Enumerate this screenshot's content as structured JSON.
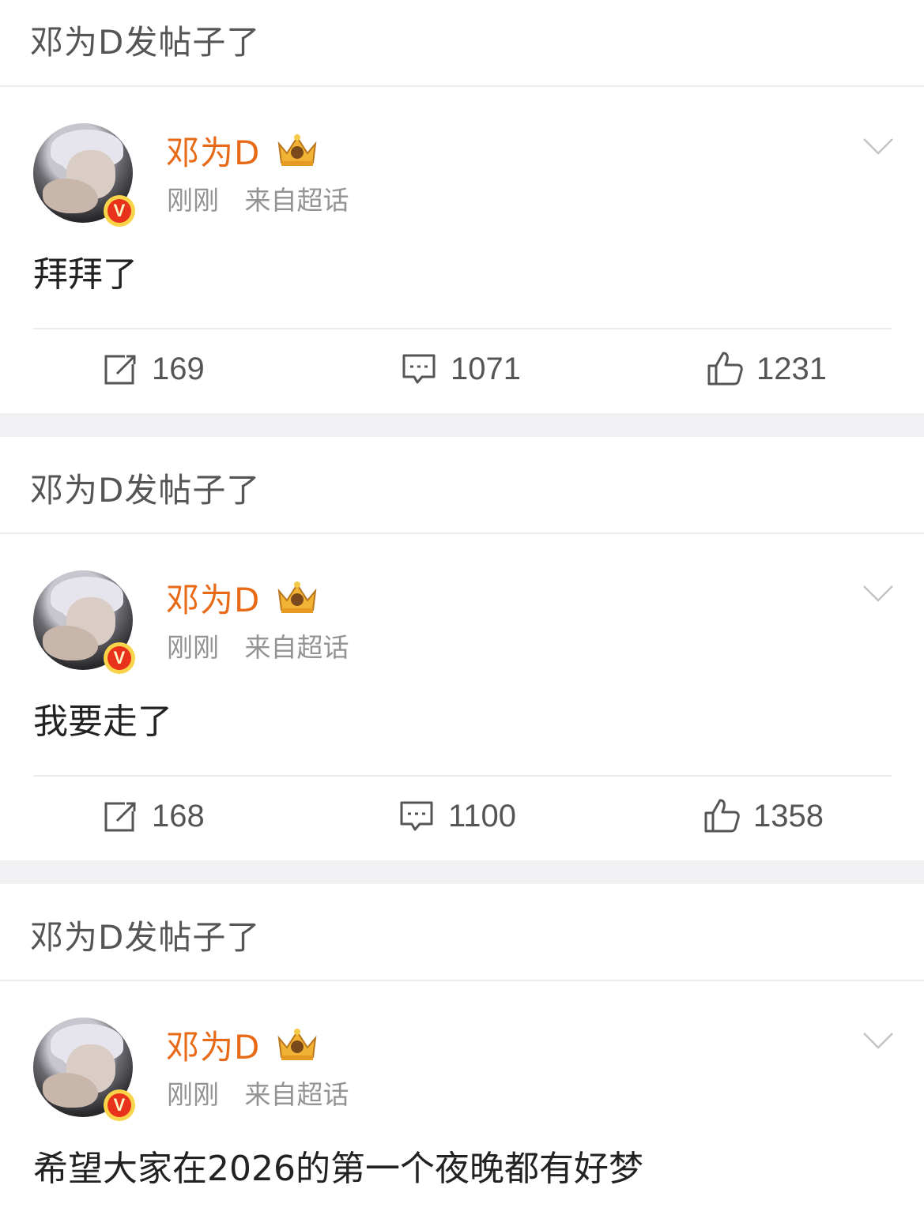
{
  "feed": [
    {
      "header": "邓为D发帖子了",
      "user": {
        "name": "邓为D",
        "verified_badge": "V"
      },
      "meta": {
        "time": "刚刚",
        "source": "来自超话"
      },
      "text": "拜拜了",
      "actions": {
        "reposts": "169",
        "comments": "1071",
        "likes": "1231"
      }
    },
    {
      "header": "邓为D发帖子了",
      "user": {
        "name": "邓为D",
        "verified_badge": "V"
      },
      "meta": {
        "time": "刚刚",
        "source": "来自超话"
      },
      "text": "我要走了",
      "actions": {
        "reposts": "168",
        "comments": "1100",
        "likes": "1358"
      }
    },
    {
      "header": "邓为D发帖子了",
      "user": {
        "name": "邓为D",
        "verified_badge": "V"
      },
      "meta": {
        "time": "刚刚",
        "source": "来自超话"
      },
      "text": "希望大家在2026的第一个夜晚都有好梦"
    }
  ],
  "colors": {
    "username": "#e86a17",
    "meta": "#939393",
    "separator": "#f1f1f3",
    "badge_red": "#e8321b",
    "badge_gold": "#f8d44a"
  },
  "icons": [
    "crown-icon",
    "chevron-down-icon",
    "repost-icon",
    "comment-icon",
    "like-icon"
  ]
}
